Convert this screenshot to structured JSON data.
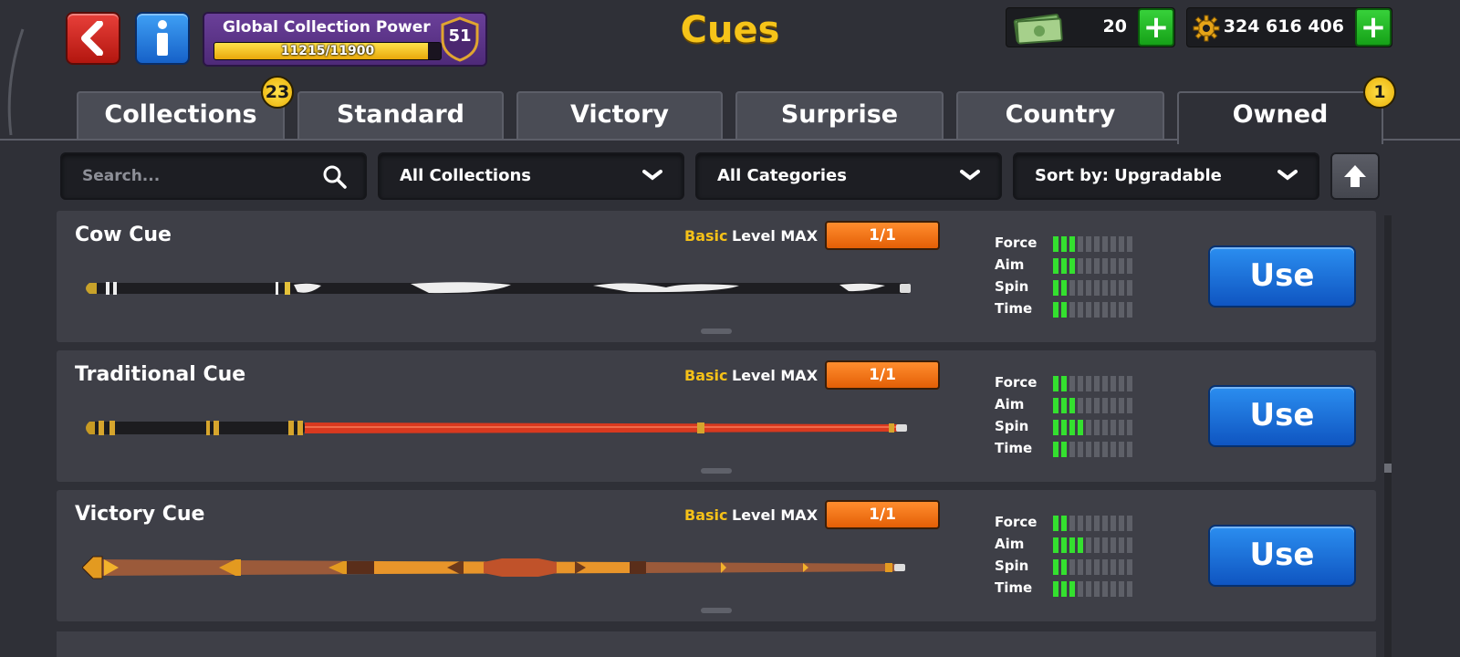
{
  "header": {
    "title": "Cues",
    "collection_power": {
      "label": "Global Collection Power",
      "progress_text": "11215/11900",
      "progress_fraction": 0.942,
      "level": "51"
    },
    "currencies": {
      "cash": "20",
      "coins": "324 616 406"
    }
  },
  "tabs": [
    {
      "label": "Collections",
      "badge": "23",
      "active": false
    },
    {
      "label": "Standard",
      "active": false
    },
    {
      "label": "Victory",
      "active": false
    },
    {
      "label": "Surprise",
      "active": false
    },
    {
      "label": "Country",
      "active": false
    },
    {
      "label": "Owned",
      "badge": "1",
      "active": true
    }
  ],
  "filters": {
    "search_placeholder": "Search...",
    "collections": "All Collections",
    "categories": "All Categories",
    "sort": "Sort by: Upgradable"
  },
  "stat_labels": [
    "Force",
    "Aim",
    "Spin",
    "Time"
  ],
  "cues": [
    {
      "name": "Cow Cue",
      "rarity": "Basic",
      "level_label": "Level MAX",
      "level_value": "1/1",
      "stats": {
        "Force": 3,
        "Aim": 3,
        "Spin": 2,
        "Time": 2
      },
      "button": "Use"
    },
    {
      "name": "Traditional Cue",
      "rarity": "Basic",
      "level_label": "Level MAX",
      "level_value": "1/1",
      "stats": {
        "Force": 2,
        "Aim": 3,
        "Spin": 4,
        "Time": 2
      },
      "button": "Use"
    },
    {
      "name": "Victory Cue",
      "rarity": "Basic",
      "level_label": "Level MAX",
      "level_value": "1/1",
      "stats": {
        "Force": 2,
        "Aim": 4,
        "Spin": 2,
        "Time": 3
      },
      "button": "Use"
    }
  ],
  "stat_max": 10,
  "colors": {
    "accent_yellow": "#f6c419",
    "stat_on": "#34e02f",
    "use_button": "#1f74dc",
    "level_box": "#f57a1a"
  }
}
